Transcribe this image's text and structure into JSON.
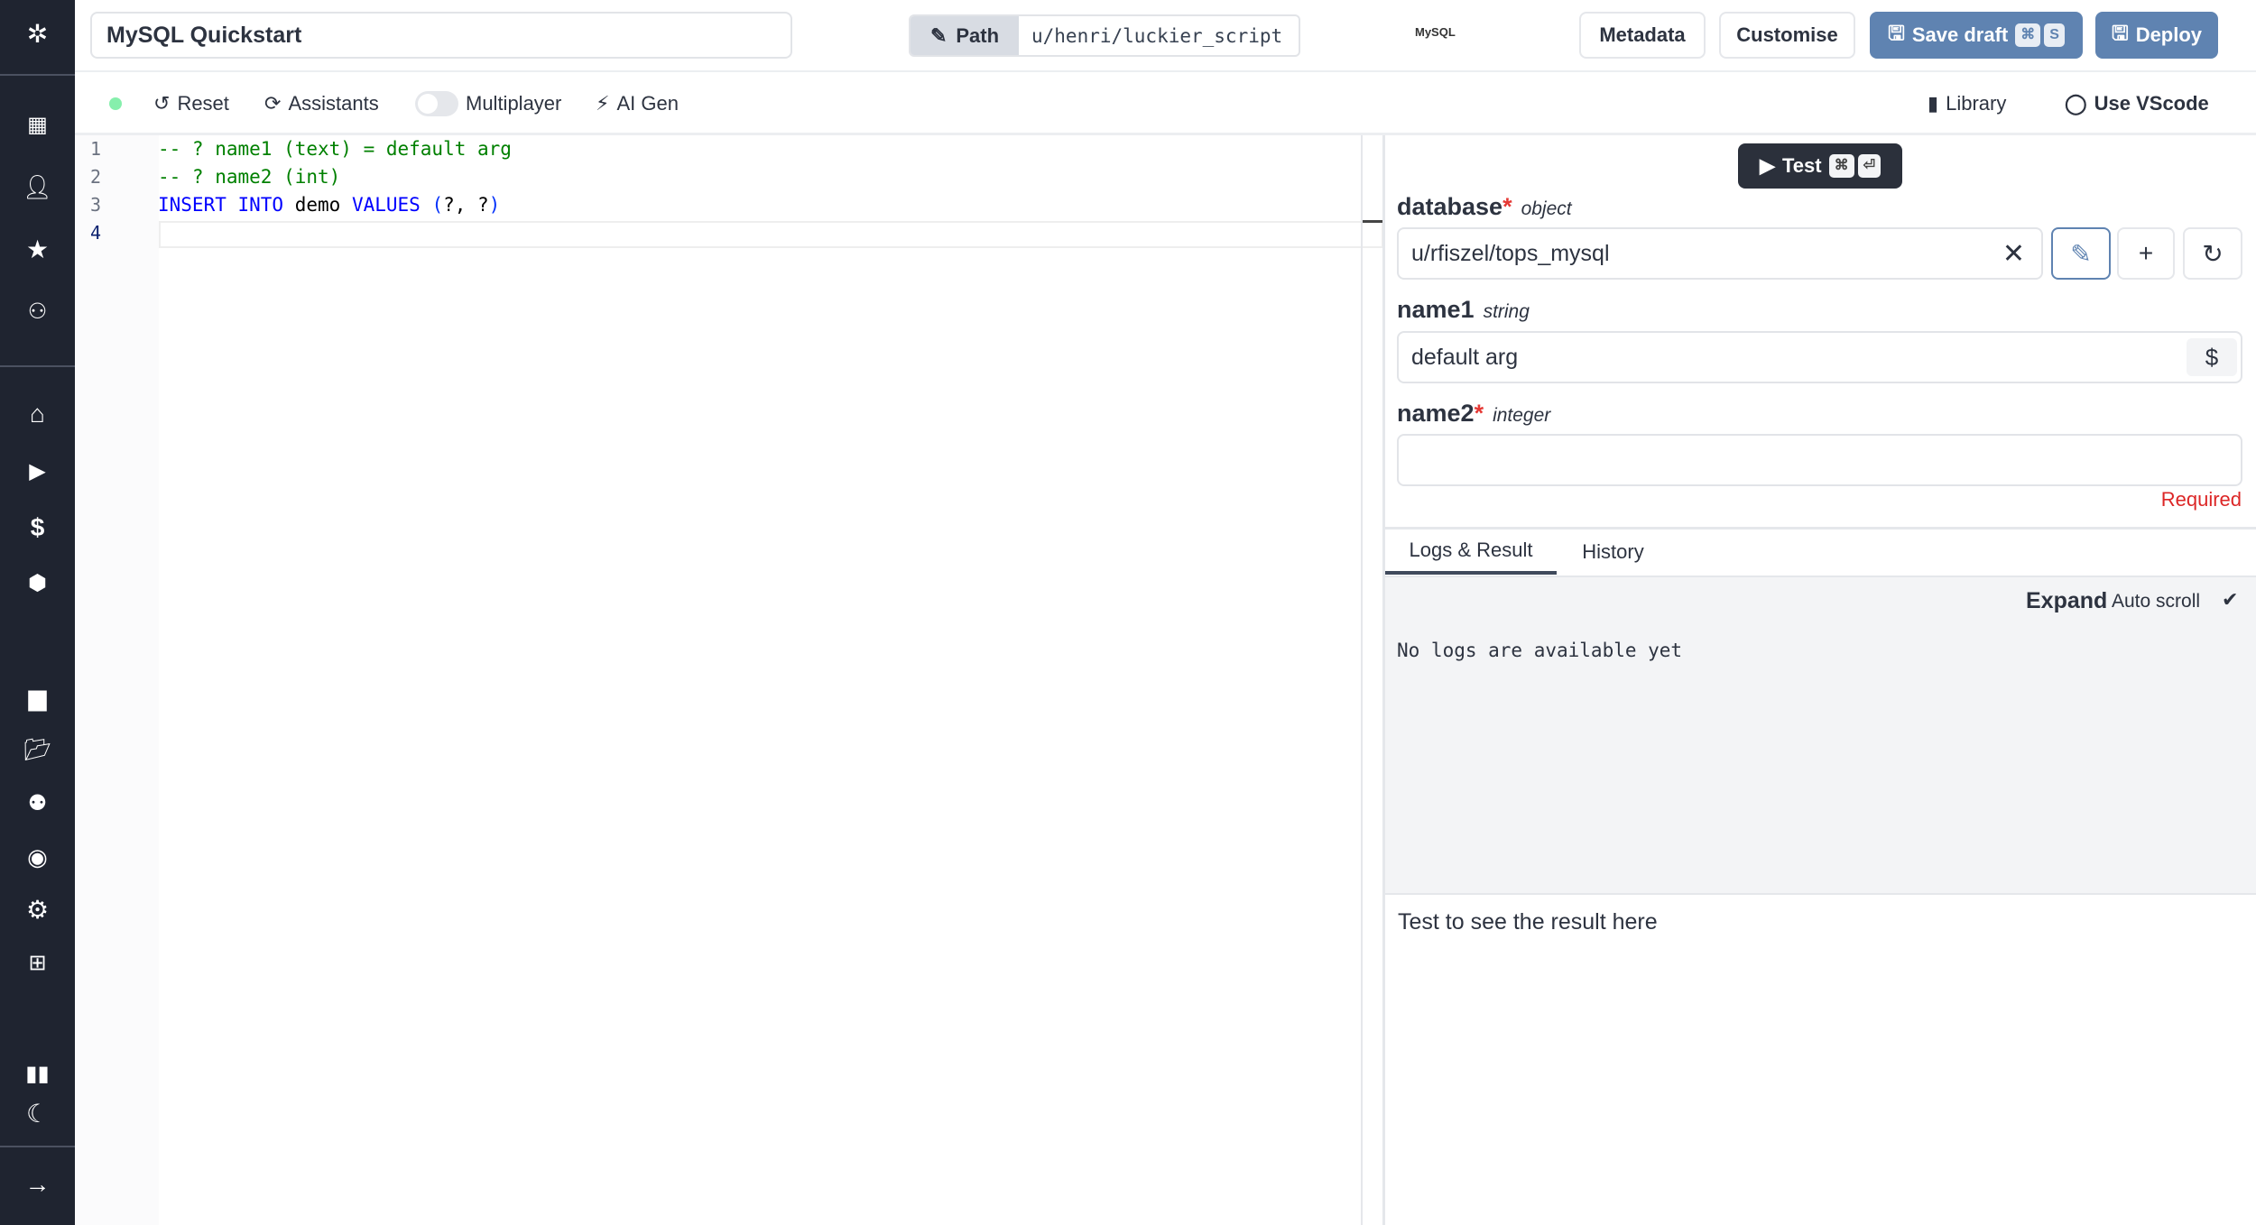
{
  "header": {
    "title": "MySQL Quickstart",
    "path_label": "Path",
    "path_value": "u/henri/luckier_script",
    "logo": "MySQL",
    "metadata": "Metadata",
    "customise": "Customise",
    "save_draft": "Save draft",
    "save_kbd1": "⌘",
    "save_kbd2": "S",
    "deploy": "Deploy"
  },
  "toolbar": {
    "reset": "Reset",
    "assistants": "Assistants",
    "multiplayer": "Multiplayer",
    "multiplayer_on": false,
    "ai_gen": "AI Gen",
    "library": "Library",
    "vscode": "Use VScode",
    "status_color": "#86efac"
  },
  "editor": {
    "line_numbers": [
      "1",
      "2",
      "3",
      "4"
    ],
    "lines": [
      [
        {
          "t": "-- ? name1 (text) = default arg",
          "c": "#008000"
        }
      ],
      [
        {
          "t": "-- ? name2 (int)",
          "c": "#008000"
        }
      ],
      [
        {
          "t": "INSERT INTO",
          "c": "#0000ff"
        },
        {
          "t": " demo ",
          "c": "#000000"
        },
        {
          "t": "VALUES",
          "c": "#0000ff"
        },
        {
          "t": " (",
          "c": "#0431fa"
        },
        {
          "t": "?, ?",
          "c": "#000000"
        },
        {
          "t": ")",
          "c": "#0431fa"
        }
      ],
      []
    ]
  },
  "test": {
    "label": "Test",
    "kbd1": "⌘",
    "kbd2": "⏎"
  },
  "form": {
    "database": {
      "name": "database",
      "type": "object",
      "value": "u/rfiszel/tops_mysql"
    },
    "name1": {
      "name": "name1",
      "type": "string",
      "value": "default arg"
    },
    "name2": {
      "name": "name2",
      "type": "integer",
      "value": "",
      "error": "Required"
    }
  },
  "results": {
    "tabs": [
      "Logs & Result",
      "History"
    ],
    "active_tab": 0,
    "expand": "Expand",
    "auto_scroll": "Auto scroll",
    "auto_scroll_checked": true,
    "no_logs": "No logs are available yet",
    "placeholder": "Test to see the result here"
  }
}
